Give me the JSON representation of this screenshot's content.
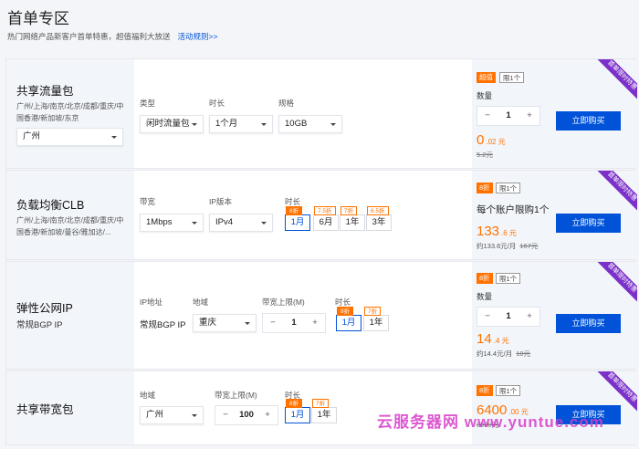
{
  "header": {
    "title": "首单专区",
    "subtitle": "热门网络产品新客户首单特惠，超值福利大放送",
    "link": "活动规则>>"
  },
  "ribbon_text": "首单限时特惠",
  "buy_label": "立即购买",
  "cards": [
    {
      "name": "共享流量包",
      "regions": "广州/上海/南京/北京/成都/重庆/中国香港/新加坡/东京",
      "region_value": "广州",
      "type_label": "类型",
      "type_value": "闲时流量包",
      "duration_label": "时长",
      "duration_value": "1个月",
      "spec_label": "规格",
      "spec_value": "10GB",
      "tag1": "超值",
      "tag2": "限1个",
      "qty_label": "数量",
      "qty": "1",
      "price": "0",
      "price_unit": ".02 元",
      "orig": "5.2元"
    },
    {
      "name": "负载均衡CLB",
      "regions": "广州/上海/南京/北京/成都/重庆/中国香港/新加坡/曼谷/雅加达/...",
      "bw_label": "带宽",
      "bw_value": "1Mbps",
      "ip_label": "IP版本",
      "ip_value": "IPv4",
      "dur_label": "时长",
      "durations": [
        {
          "label": "1月",
          "badge": "8折"
        },
        {
          "label": "6月",
          "badge": "7.5折"
        },
        {
          "label": "1年",
          "badge": "7折"
        },
        {
          "label": "3年",
          "badge": "6.5折"
        }
      ],
      "tag1": "8折",
      "tag2": "限1个",
      "limit_text": "每个账户限购1个",
      "price": "133",
      "price_unit": ".6 元",
      "sub": "约133.6元/月",
      "orig": "167元"
    },
    {
      "name": "弹性公网IP",
      "desc": "常规BGP IP",
      "ipaddr_label": "IP地址",
      "ipaddr_value": "常规BGP IP",
      "region_label": "地域",
      "region_value": "重庆",
      "bw_label": "带宽上限(M)",
      "bw_value": "1",
      "dur_label": "时长",
      "durations": [
        {
          "label": "1月",
          "badge": "8折"
        },
        {
          "label": "1年",
          "badge": "7折"
        }
      ],
      "tag1": "8折",
      "tag2": "限1个",
      "qty_label": "数量",
      "qty": "1",
      "price": "14",
      "price_unit": ".4 元",
      "sub": "约14.4元/月",
      "orig": "18元"
    },
    {
      "name": "共享带宽包",
      "region_label": "地域",
      "region_value": "广州",
      "bw_label": "带宽上限(M)",
      "bw_value": "100",
      "dur_label": "时长",
      "durations": [
        {
          "label": "1月",
          "badge": "8折"
        },
        {
          "label": "1年",
          "badge": "7折"
        }
      ],
      "tag1": "8折",
      "tag2": "限1个",
      "price": "6400",
      "price_unit": ".00 元",
      "orig": "8000元"
    }
  ],
  "watermark": "云服务器网 www.yuntue.com"
}
